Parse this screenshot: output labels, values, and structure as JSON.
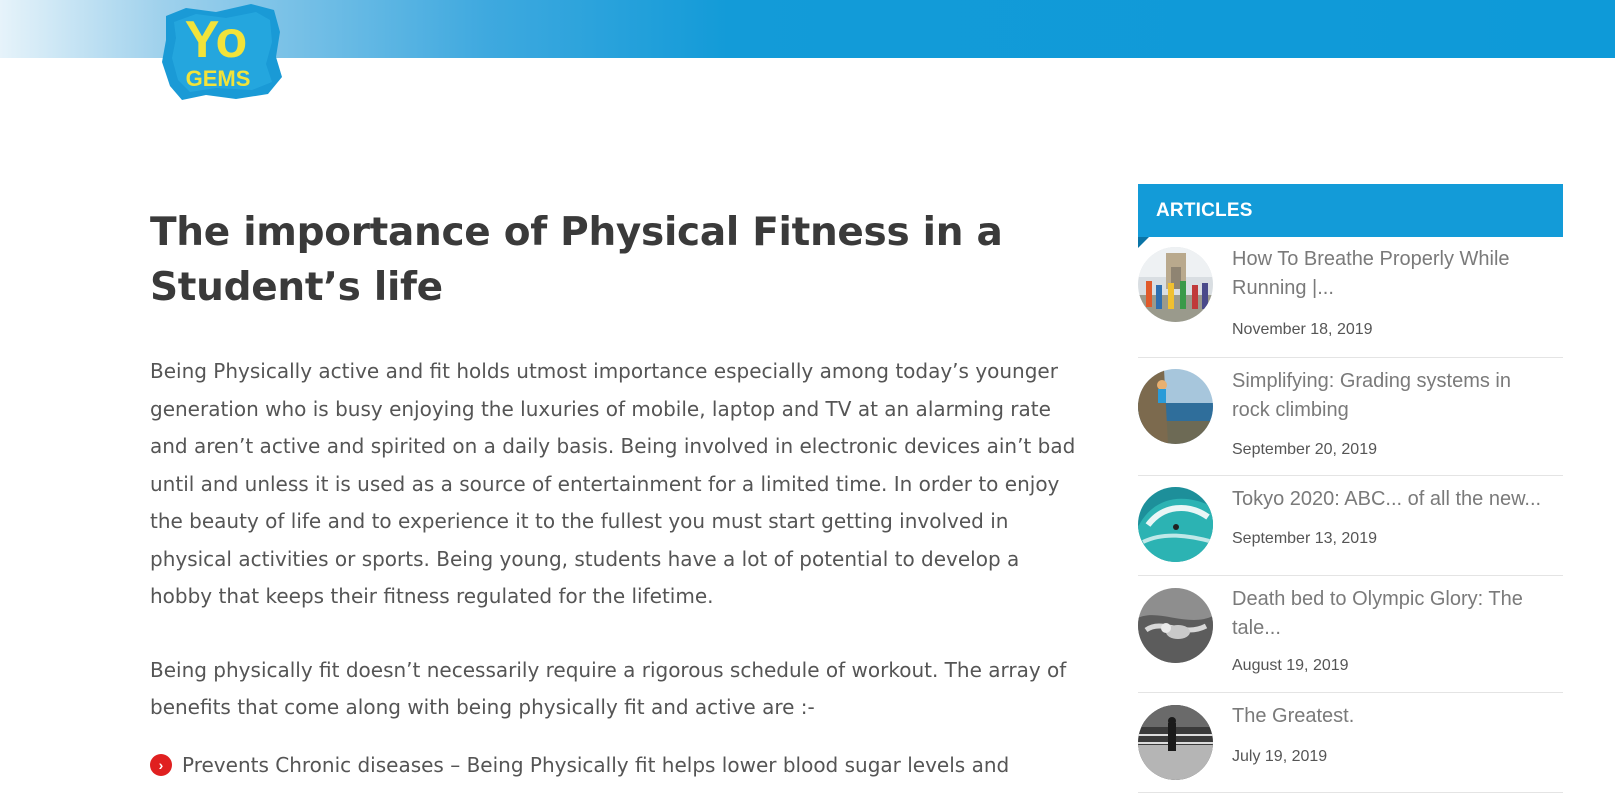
{
  "header": {
    "logo": {
      "text_top": "Yo",
      "text_bottom": "GEMS"
    }
  },
  "article": {
    "title": "The importance of Physical Fitness in a Student’s life",
    "paragraphs": [
      "Being Physically active and fit holds utmost importance especially among today’s younger generation who is busy enjoying the luxuries of mobile, laptop and TV at an alarming rate and aren’t active and spirited on a daily basis. Being involved in electronic devices ain’t bad until and unless it is used as a source of entertainment for a limited time. In order to enjoy the beauty of life and to experience it to the fullest you must start getting involved in physical activities or sports. Being young, students have a lot of potential to develop a hobby that keeps their fitness regulated for the lifetime.",
      "Being physically fit doesn’t necessarily require a rigorous schedule of workout. The array of benefits that come along with being physically fit and active are :-"
    ],
    "bullets": [
      {
        "icon": "chevron-right-circle-icon",
        "text": "Prevents Chronic diseases – Being Physically fit helps lower blood sugar levels and"
      }
    ]
  },
  "sidebar": {
    "heading": "ARTICLES",
    "accent_color": "#139bd8",
    "items": [
      {
        "title": "How To Breathe Properly While Running |...",
        "date": "November 18, 2019",
        "thumb": "runners-photo"
      },
      {
        "title": "Simplifying: Grading systems in rock climbing",
        "date": "September 20, 2019",
        "thumb": "climber-photo"
      },
      {
        "title": "Tokyo 2020: ABC... of all the new...",
        "date": "September 13, 2019",
        "thumb": "surf-wave-photo"
      },
      {
        "title": "Death bed to Olympic Glory: The tale...",
        "date": "August 19, 2019",
        "thumb": "swimmer-photo"
      },
      {
        "title": "The Greatest.",
        "date": "July 19, 2019",
        "thumb": "boxing-ring-photo"
      }
    ]
  }
}
